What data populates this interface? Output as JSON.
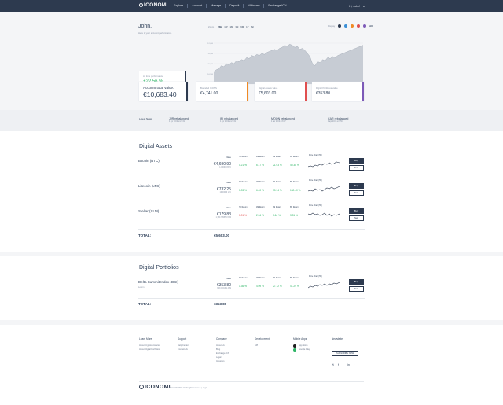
{
  "nav": {
    "logo": "ICONOMI",
    "links": [
      "Explore",
      "Account",
      "Manage",
      "Deposit",
      "Withdraw",
      "Exchange ICN"
    ],
    "user": "Hi, John!"
  },
  "hero": {
    "greeting": "John,",
    "subtitle": "Here is your account performance.",
    "zoom_label": "Zoom",
    "ranges": [
      "24H",
      "1W",
      "1M",
      "3M",
      "6M",
      "1Y",
      "All"
    ],
    "active_range": "24H",
    "modes_label": "Display",
    "modes_all": "All",
    "mode_colors": [
      "#2d3a4f",
      "#3a8fd6",
      "#f08a24",
      "#e04f4f",
      "#7d5ab8"
    ],
    "performance_label": "All time performance",
    "performance_value": "+22.56 %"
  },
  "chart_data": {
    "type": "area",
    "title": "",
    "x_ticks": [
      "11:00",
      "12:00",
      "13:00",
      "14:00"
    ],
    "y_ticks": [
      "12,000",
      "11,500",
      "11,000",
      "10,500",
      "10,000"
    ],
    "values": [
      10600,
      10700,
      10750,
      10900,
      10850,
      11000,
      10950,
      11050,
      11000,
      11150,
      11100,
      11200,
      11150,
      11300,
      11250,
      11400,
      11350,
      11450,
      11400,
      11500,
      11450,
      11550,
      11600,
      11650,
      11700,
      11650,
      11750,
      11800,
      11900,
      11850,
      11950,
      11900,
      11800,
      11850,
      11700,
      11750,
      11650,
      11500,
      11350,
      11000,
      10900,
      11100,
      11050,
      11200,
      11150,
      11300,
      11250,
      11350,
      11300,
      11400,
      11450,
      11500,
      11550,
      11600,
      11650,
      11700,
      11750,
      11800,
      11850,
      11900
    ],
    "ylim": [
      10000,
      12000
    ],
    "fill_color": "#c7ccd4"
  },
  "cards": [
    {
      "label": "Account total value:",
      "value": "€10,683.40",
      "accent": "#2d3a4f"
    },
    {
      "label": "Bounded ICONS",
      "value": "€4,741.00",
      "accent": "#f08a24"
    },
    {
      "label": "Digital Assets value",
      "value": "€5,603.00",
      "accent": "#e04f4f"
    },
    {
      "label": "Digital Portfolios value",
      "value": "€353.80",
      "accent": "#7d5ab8"
    }
  ],
  "news": {
    "title": "Latest News",
    "items": [
      {
        "title": "JJR rebalanced",
        "date": "4 apr 2019 at 21:19"
      },
      {
        "title": "IFI rebalanced",
        "date": "4 apr 2019 at 21:19"
      },
      {
        "title": "MOON rebalanced",
        "date": "4 apr 2019 at 8:17"
      },
      {
        "title": "CAR rebalanced",
        "date": "4 apr 2019 at 7:56"
      }
    ]
  },
  "assets": {
    "title": "Digital Assets",
    "value_header": "Value",
    "return_headers": [
      "7D Return",
      "1M Return",
      "3M Return",
      "6M Return"
    ],
    "spark_header": "Price Chart (7D)",
    "buy": "Buy",
    "sell": "Sell",
    "rows": [
      {
        "name": "Bitcoin (BTC)",
        "value": "€4,690.90",
        "units": "1.000000 BTC",
        "returns": [
          "0.21 %",
          "6.17 %",
          "21.93 %",
          "40.38 %"
        ],
        "neg": [
          false,
          false,
          false,
          false
        ]
      },
      {
        "name": "Litecoin (LTC)",
        "value": "€732.25",
        "units": "10.00000 LTC",
        "returns": [
          "1.03 %",
          "6.40 %",
          "30.14 %",
          "130.40 %"
        ],
        "neg": [
          false,
          false,
          false,
          false
        ]
      },
      {
        "name": "Stellar (XLM)",
        "value": "€179.83",
        "units": "1,750.705854 XLM",
        "returns": [
          "1.01 %",
          "2.54 %",
          "1.64 %",
          "3.31 %"
        ],
        "neg": [
          true,
          false,
          false,
          false
        ]
      }
    ],
    "total_label": "TOTAL:",
    "total_value": "€5,603.00"
  },
  "portfolios": {
    "title": "Digital Portfolios",
    "rows": [
      {
        "name": "Delta Summit Index (DSI)",
        "sub": "Lowm",
        "value": "€353.80",
        "units": "356.0001661 DSI",
        "returns": [
          "1.36 %",
          "4.09 %",
          "27.72 %",
          "41.29 %"
        ],
        "neg": [
          false,
          false,
          false,
          false
        ]
      }
    ],
    "total_label": "TOTAL:",
    "total_value": "€353.80"
  },
  "footer": {
    "cols": [
      {
        "head": "Learn More",
        "links": [
          "About Cryptocurrencies",
          "About Digital Portfolios"
        ]
      },
      {
        "head": "Support",
        "links": [
          "Help Center",
          "Contact Us"
        ]
      },
      {
        "head": "Company",
        "links": [
          "About Us",
          "Blog",
          "Exchange ICN",
          "Legal",
          "Investors"
        ]
      },
      {
        "head": "Development",
        "links": [
          "API"
        ]
      }
    ],
    "mobile_head": "Mobile Apps",
    "app_store": "App Store",
    "google_play": "Google Play",
    "newsletter_head": "Newsletter",
    "subscribe": "SUBSCRIBE NOW",
    "social_icons": [
      "mail-icon",
      "facebook-icon",
      "twitter-icon",
      "linkedin-icon",
      "reddit-icon"
    ],
    "social_glyphs": [
      "✉",
      "f",
      "t",
      "in",
      "r"
    ],
    "logo": "ICONOMI",
    "copyright": "© 2019 ICONOMI Ltd. All rights reserved. | Legal"
  }
}
